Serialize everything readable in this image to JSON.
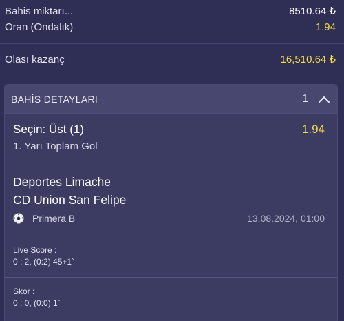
{
  "summary": {
    "stake_label": "Bahis miktarı...",
    "stake_value": "8510.64 ₺",
    "odds_label": "Oran (Ondalık)",
    "odds_value": "1.94",
    "potential_label": "Olası kazanç",
    "potential_value": "16,510.64 ₺"
  },
  "details": {
    "title": "BAHİS DETAYLARI",
    "count": "1",
    "selection": "Seçin: Üst (1)",
    "selection_odds": "1.94",
    "market": "1. Yarı Toplam Gol",
    "home_team": "Deportes Limache",
    "away_team": "CD Union San Felipe",
    "league": "Primera B",
    "datetime": "13.08.2024, 01:00",
    "live_score_label": "Live Score :",
    "live_score_value": "0 : 2, (0:2) 45+1`",
    "score_label": "Skor :",
    "score_value": "0 : 0, (0:0) 1`"
  },
  "colors": {
    "background": "#2f2f56",
    "card": "#3c3c63",
    "accent_yellow": "#f5d94a"
  },
  "icons": {
    "collapse": "chevron-up-icon",
    "sport": "soccer-ball-icon"
  }
}
